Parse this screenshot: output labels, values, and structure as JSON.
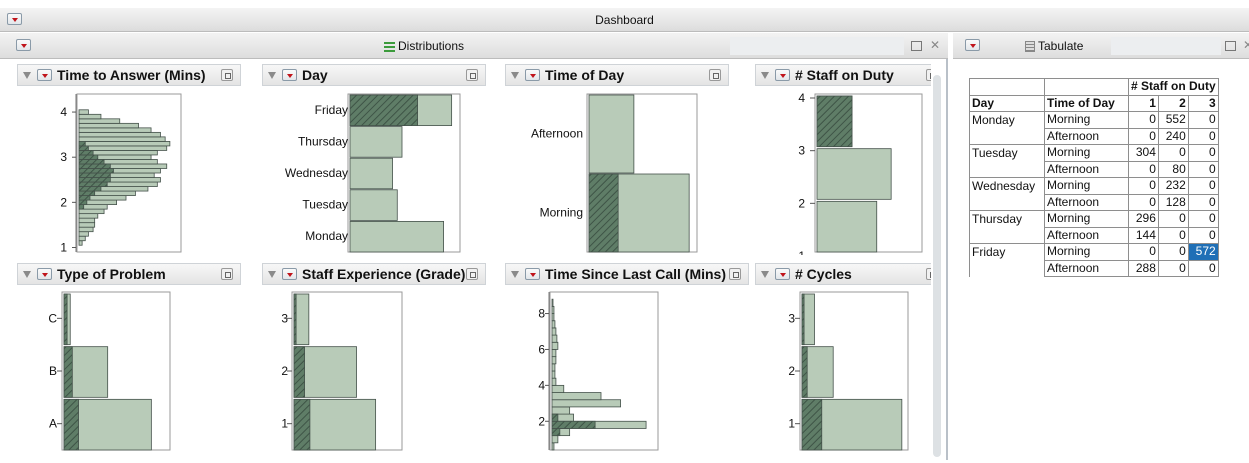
{
  "window": {
    "title": "Dashboard"
  },
  "distributions": {
    "title": "Distributions",
    "charts": [
      {
        "title": "Time to Answer (Mins)",
        "type": "histogram",
        "ticks": [
          "1",
          "2",
          "3",
          "4"
        ],
        "tick_values": [
          1,
          2,
          3,
          4
        ],
        "range": [
          0.9,
          4.4
        ],
        "bins": [
          [
            1.1,
            2
          ],
          [
            1.2,
            4
          ],
          [
            1.3,
            6
          ],
          [
            1.4,
            9
          ],
          [
            1.5,
            10
          ],
          [
            1.6,
            10
          ],
          [
            1.7,
            12
          ],
          [
            1.8,
            16
          ],
          [
            1.9,
            18
          ],
          [
            2.0,
            24
          ],
          [
            2.1,
            30
          ],
          [
            2.2,
            36
          ],
          [
            2.3,
            44
          ],
          [
            2.4,
            50
          ],
          [
            2.5,
            52
          ],
          [
            2.6,
            48
          ],
          [
            2.7,
            52
          ],
          [
            2.8,
            56
          ],
          [
            2.9,
            50
          ],
          [
            3.0,
            46
          ],
          [
            3.1,
            50
          ],
          [
            3.2,
            56
          ],
          [
            3.3,
            58
          ],
          [
            3.4,
            55
          ],
          [
            3.5,
            52
          ],
          [
            3.6,
            46
          ],
          [
            3.7,
            38
          ],
          [
            3.8,
            26
          ],
          [
            3.9,
            14
          ],
          [
            4.0,
            6
          ]
        ],
        "selected": [
          [
            1.9,
            3
          ],
          [
            2.0,
            5
          ],
          [
            2.1,
            7
          ],
          [
            2.2,
            10
          ],
          [
            2.3,
            14
          ],
          [
            2.4,
            18
          ],
          [
            2.5,
            20
          ],
          [
            2.6,
            20
          ],
          [
            2.7,
            22
          ],
          [
            2.8,
            20
          ],
          [
            2.9,
            16
          ],
          [
            3.0,
            12
          ],
          [
            3.1,
            9
          ],
          [
            3.2,
            6
          ],
          [
            3.3,
            4
          ]
        ],
        "max": 60
      },
      {
        "title": "Day",
        "type": "bar_h",
        "categories": [
          "Friday",
          "Thursday",
          "Wednesday",
          "Tuesday",
          "Monday"
        ],
        "values": [
          860,
          440,
          360,
          400,
          792
        ],
        "selected": [
          572,
          0,
          0,
          0,
          0
        ],
        "max": 880
      },
      {
        "title": "Time of Day",
        "type": "bar_h",
        "categories": [
          "Afternoon",
          "Morning"
        ],
        "values": [
          880,
          1964
        ],
        "selected": [
          0,
          572
        ],
        "max": 2000
      },
      {
        "title": "# Staff on Duty",
        "type": "bar_v_cat",
        "ticks": [
          "4",
          "3",
          "2",
          "1"
        ],
        "values": [
          0.34,
          0.72,
          0.58
        ],
        "selected": [
          0.34,
          0,
          0
        ]
      },
      {
        "title": "Type of Problem",
        "type": "bar_v_cat",
        "ticks": [
          "C",
          "B",
          "A"
        ],
        "values": [
          0.06,
          0.42,
          0.84
        ],
        "selected": [
          0.03,
          0.08,
          0.14
        ]
      },
      {
        "title": "Staff Experience (Grade)",
        "type": "bar_v_cat",
        "ticks": [
          "3",
          "2",
          "1"
        ],
        "values": [
          0.14,
          0.59,
          0.77
        ],
        "selected": [
          0.02,
          0.1,
          0.15
        ]
      },
      {
        "title": "Time Since Last Call (Mins)",
        "type": "histogram",
        "ticks": [
          "2",
          "4",
          "6",
          "8"
        ],
        "tick_values": [
          2,
          4,
          6,
          8
        ],
        "range": [
          0.4,
          9.2
        ],
        "bins": [
          [
            0.6,
            2
          ],
          [
            1.0,
            6
          ],
          [
            1.4,
            18
          ],
          [
            1.8,
            96
          ],
          [
            2.2,
            22
          ],
          [
            2.6,
            18
          ],
          [
            3.0,
            70
          ],
          [
            3.4,
            50
          ],
          [
            3.8,
            12
          ],
          [
            4.2,
            4
          ],
          [
            4.6,
            3
          ],
          [
            5.0,
            3
          ],
          [
            5.4,
            4
          ],
          [
            5.8,
            4
          ],
          [
            6.2,
            6
          ],
          [
            6.6,
            5
          ],
          [
            7.0,
            4
          ],
          [
            7.4,
            3
          ],
          [
            7.8,
            2
          ],
          [
            8.2,
            2
          ],
          [
            8.6,
            1
          ]
        ],
        "selected": [
          [
            1.4,
            8
          ],
          [
            1.8,
            44
          ],
          [
            2.2,
            6
          ]
        ],
        "max": 100
      },
      {
        "title": "# Cycles",
        "type": "bar_v_cat",
        "ticks": [
          "3",
          "2",
          "1"
        ],
        "values": [
          0.12,
          0.3,
          0.96
        ],
        "selected": [
          0.02,
          0.05,
          0.19
        ]
      }
    ]
  },
  "tabulate": {
    "title": "Tabulate",
    "header_group": "# Staff on Duty",
    "col_day": "Day",
    "col_time": "Time of Day",
    "staff_cols": [
      "1",
      "2",
      "3"
    ],
    "rows": [
      {
        "day": "Monday",
        "time": "Morning",
        "v": [
          "0",
          "552",
          "0"
        ]
      },
      {
        "day": "",
        "time": "Afternoon",
        "v": [
          "0",
          "240",
          "0"
        ]
      },
      {
        "day": "Tuesday",
        "time": "Morning",
        "v": [
          "304",
          "0",
          "0"
        ]
      },
      {
        "day": "",
        "time": "Afternoon",
        "v": [
          "0",
          "80",
          "0"
        ]
      },
      {
        "day": "Wednesday",
        "time": "Morning",
        "v": [
          "0",
          "232",
          "0"
        ]
      },
      {
        "day": "",
        "time": "Afternoon",
        "v": [
          "0",
          "128",
          "0"
        ]
      },
      {
        "day": "Thursday",
        "time": "Morning",
        "v": [
          "296",
          "0",
          "0"
        ]
      },
      {
        "day": "",
        "time": "Afternoon",
        "v": [
          "144",
          "0",
          "0"
        ]
      },
      {
        "day": "Friday",
        "time": "Morning",
        "v": [
          "0",
          "0",
          "572"
        ]
      },
      {
        "day": "",
        "time": "Afternoon",
        "v": [
          "288",
          "0",
          "0"
        ]
      }
    ],
    "selected_cell": {
      "row": 8,
      "col": 2
    }
  },
  "colors": {
    "bar_fill": "#b8cbb8",
    "bar_stroke": "#44514a",
    "selected_fill": "#5f7d67",
    "accent_red": "#c0141b",
    "selection": "#1f6fb6"
  }
}
